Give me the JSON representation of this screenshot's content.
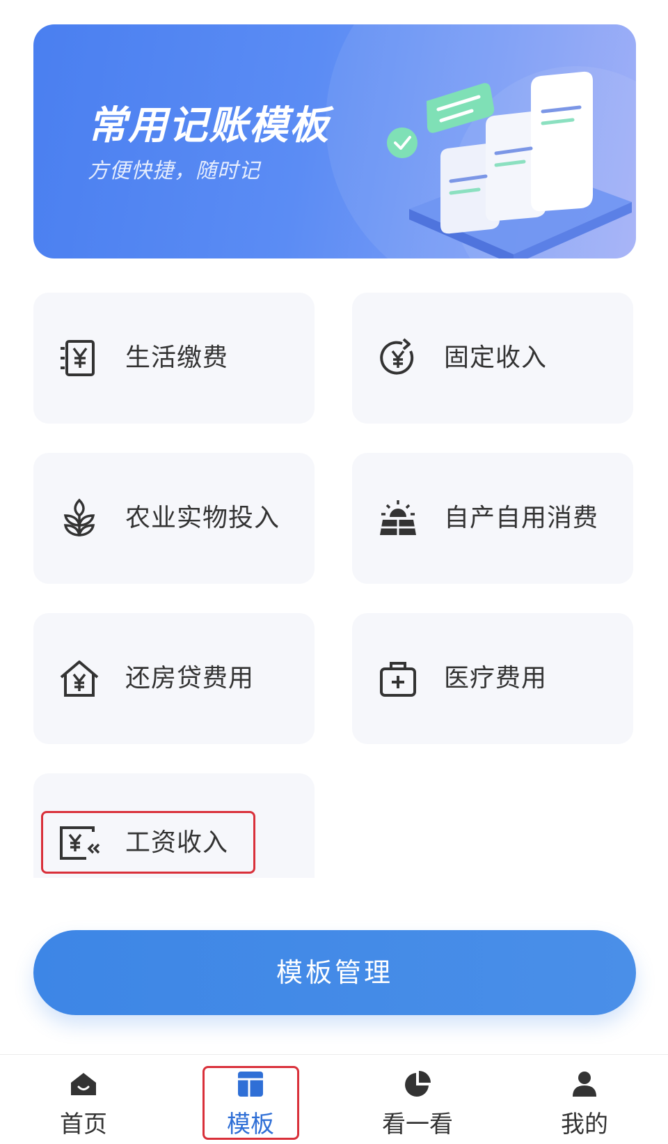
{
  "banner": {
    "title": "常用记账模板",
    "subtitle": "方便快捷，随时记"
  },
  "templates": [
    {
      "label": "生活缴费",
      "icon": "receipt-yen-icon"
    },
    {
      "label": "固定收入",
      "icon": "yen-refresh-icon"
    },
    {
      "label": "农业实物投入",
      "icon": "wheat-icon"
    },
    {
      "label": "自产自用消费",
      "icon": "sunrise-field-icon"
    },
    {
      "label": "还房贷费用",
      "icon": "house-yen-icon"
    },
    {
      "label": "医疗费用",
      "icon": "medical-kit-icon"
    },
    {
      "label": "工资收入",
      "icon": "salary-card-icon"
    }
  ],
  "manage_button": {
    "label": "模板管理"
  },
  "tabbar": {
    "items": [
      {
        "label": "首页",
        "icon": "home-icon"
      },
      {
        "label": "模板",
        "icon": "template-grid-icon"
      },
      {
        "label": "看一看",
        "icon": "pie-chart-icon"
      },
      {
        "label": "我的",
        "icon": "user-icon"
      }
    ],
    "active_index": 1
  },
  "colors": {
    "accent": "#3d86e6",
    "active_tab": "#2f6fd6",
    "highlight": "#d9303a",
    "card_bg": "#f6f7fb"
  }
}
